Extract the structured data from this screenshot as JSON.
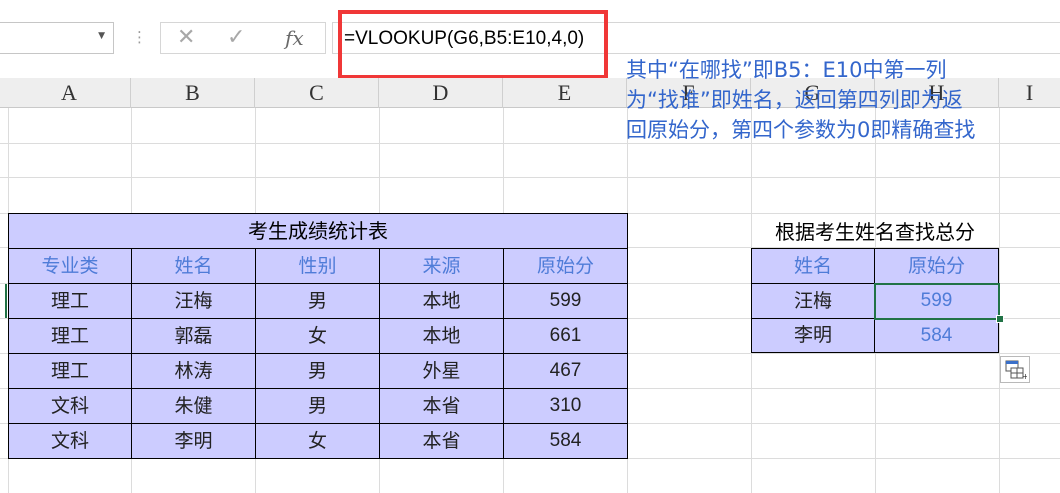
{
  "formula_bar": {
    "name_box_value": "",
    "formula": "=VLOOKUP(G6,B5:E10,4,0)",
    "top_fragment": ""
  },
  "columns": [
    "A",
    "B",
    "C",
    "D",
    "E",
    "F",
    "G",
    "H",
    "I"
  ],
  "annotation": {
    "lines": [
      "其中“在哪找”即B5：E10中第一列",
      "为“找谁”即姓名，返回第四列即为返",
      "回原始分，第四个参数为0即精确查找"
    ]
  },
  "main_table": {
    "title": "考生成绩统计表",
    "headers": [
      "专业类",
      "姓名",
      "性别",
      "来源",
      "原始分"
    ],
    "rows": [
      [
        "理工",
        "汪梅",
        "男",
        "本地",
        "599"
      ],
      [
        "理工",
        "郭磊",
        "女",
        "本地",
        "661"
      ],
      [
        "理工",
        "林涛",
        "男",
        "外星",
        "467"
      ],
      [
        "文科",
        "朱健",
        "男",
        "本省",
        "310"
      ],
      [
        "文科",
        "李明",
        "女",
        "本省",
        "584"
      ]
    ]
  },
  "lookup_table": {
    "title": "根据考生姓名查找总分",
    "headers": [
      "姓名",
      "原始分"
    ],
    "rows": [
      [
        "汪梅",
        "599"
      ],
      [
        "李明",
        "584"
      ]
    ]
  },
  "colors": {
    "table_fill": "#ccccff",
    "header_text": "#4f7cd8",
    "annotation_text": "#3366cc",
    "highlight_box": "#f03737",
    "selection": "#217346"
  }
}
